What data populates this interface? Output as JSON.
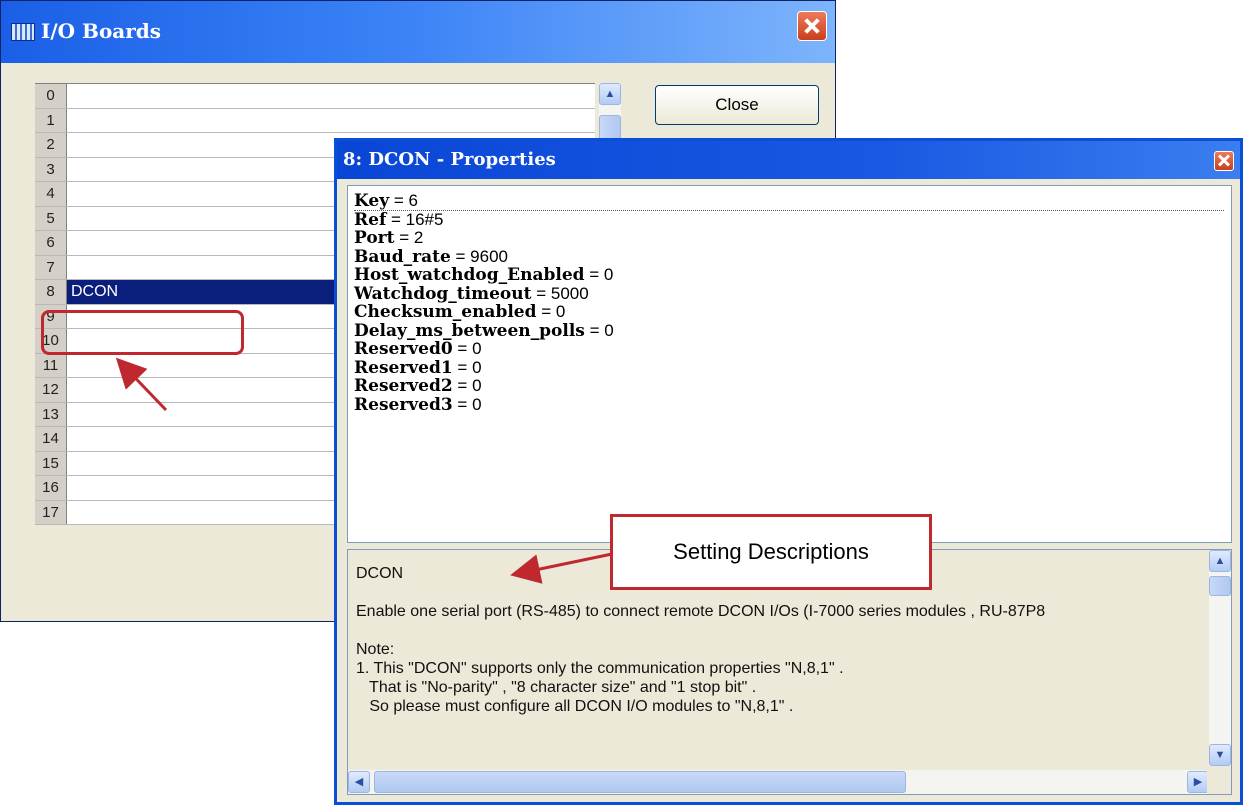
{
  "io_boards_window": {
    "title": "I/O Boards",
    "close_button_label": "Close",
    "rows": [
      {
        "num": "0",
        "value": ""
      },
      {
        "num": "1",
        "value": ""
      },
      {
        "num": "2",
        "value": ""
      },
      {
        "num": "3",
        "value": ""
      },
      {
        "num": "4",
        "value": ""
      },
      {
        "num": "5",
        "value": ""
      },
      {
        "num": "6",
        "value": ""
      },
      {
        "num": "7",
        "value": ""
      },
      {
        "num": "8",
        "value": "DCON",
        "selected": true
      },
      {
        "num": "9",
        "value": ""
      },
      {
        "num": "10",
        "value": ""
      },
      {
        "num": "11",
        "value": ""
      },
      {
        "num": "12",
        "value": ""
      },
      {
        "num": "13",
        "value": ""
      },
      {
        "num": "14",
        "value": ""
      },
      {
        "num": "15",
        "value": ""
      },
      {
        "num": "16",
        "value": ""
      },
      {
        "num": "17",
        "value": ""
      }
    ]
  },
  "properties_window": {
    "title": "8: DCON - Properties",
    "properties": [
      {
        "key": "Key",
        "value": "6"
      },
      {
        "key": "Ref",
        "value": "16#5"
      },
      {
        "key": "Port",
        "value": "2"
      },
      {
        "key": "Baud_rate",
        "value": "9600"
      },
      {
        "key": "Host_watchdog_Enabled",
        "value": "0"
      },
      {
        "key": "Watchdog_timeout",
        "value": "5000"
      },
      {
        "key": "Checksum_enabled",
        "value": "0"
      },
      {
        "key": "Delay_ms_between_polls",
        "value": "0"
      },
      {
        "key": "Reserved0",
        "value": "0"
      },
      {
        "key": "Reserved1",
        "value": "0"
      },
      {
        "key": "Reserved2",
        "value": "0"
      },
      {
        "key": "Reserved3",
        "value": "0"
      }
    ],
    "description": "DCON\n\nEnable one serial port (RS-485) to connect remote DCON I/Os (I-7000 series modules , RU-87P8\n\nNote:\n1. This \"DCON\" supports only the communication properties \"N,8,1\" .\n   That is \"No-parity\" , \"8 character size\" and \"1 stop bit\" .\n   So please must configure all DCON I/O modules to \"N,8,1\" ."
  },
  "annotation": {
    "callout_text": "Setting Descriptions",
    "accent_color": "#c0282f"
  },
  "colors": {
    "selection": "#0a1f7c",
    "titlebar": "#0a46d6",
    "window_face": "#ece9d8"
  }
}
